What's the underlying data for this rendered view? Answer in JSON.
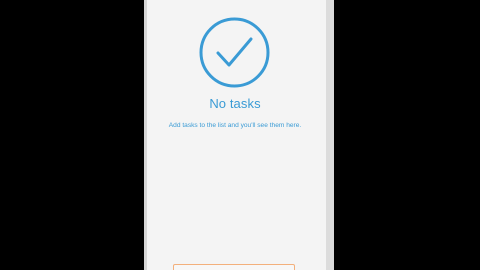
{
  "empty_state": {
    "title": "No tasks",
    "subtitle": "Add tasks to the list and you'll see them here.",
    "icon": "check-circle-icon"
  },
  "colors": {
    "accent": "#3a9bd5",
    "button_border": "#f3b07c",
    "screen_background": "#f4f4f4",
    "letterbox": "#000000"
  }
}
